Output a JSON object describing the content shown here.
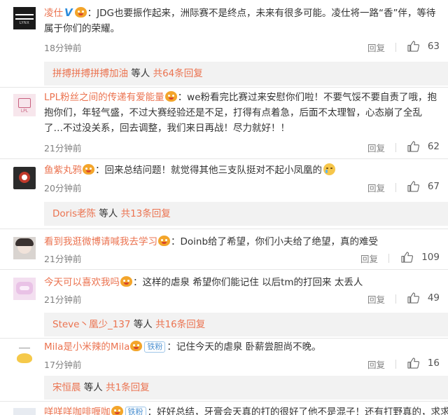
{
  "comments": [
    {
      "user": "凌仕",
      "has_v": true,
      "v_mark": "V",
      "fan_badge": "",
      "text": "：JDG也要振作起来，洲际赛不是终点，未来有很多可能。凌仕将一路“香”伴，等待属于你们的荣耀。",
      "time": "18分钟前",
      "reply_label": "回复",
      "likes": "63",
      "avatar_text": "LYNX"
    },
    {
      "user": "LPL粉丝之间的传递有爱能量",
      "has_v": false,
      "fan_badge": "",
      "text": "：we粉看完比赛过来安慰你们啦！不要气馁不要自责了哦，抱抱你们，年轻气盛，不过大赛经验还是不足，打得有点着急，后面不太理智，心态崩了全乱了…不过没关系，回去调整，我们来日再战！尽力就好！！",
      "time": "21分钟前",
      "reply_label": "回复",
      "likes": "62",
      "avatar_text": "LPL"
    },
    {
      "user": "鱼紫丸鸦",
      "has_v": false,
      "fan_badge": "",
      "text": "：回来总结问题！就觉得其他三支队挺对不起小凤凰的",
      "time": "20分钟前",
      "reply_label": "回复",
      "likes": "67",
      "avatar_text": ""
    },
    {
      "user": "看到我逛微博请喊我去学习",
      "has_v": false,
      "fan_badge": "",
      "text": "：Doinb给了希望，你们小夫给了绝望，真的难受",
      "time": "21分钟前",
      "reply_label": "回复",
      "likes": "109",
      "avatar_text": ""
    },
    {
      "user": "今天可以喜欢我吗",
      "has_v": false,
      "fan_badge": "",
      "text": "：这样的虐泉 希望你们能记住 以后tm的打回来 太丢人",
      "time": "21分钟前",
      "reply_label": "回复",
      "likes": "49",
      "avatar_text": ""
    },
    {
      "user": "Mila是小米辣的Mila",
      "has_v": false,
      "fan_badge": "铁粉",
      "text": "：记住今天的虐泉 卧薪尝胆尚不晚。",
      "time": "17分钟前",
      "reply_label": "回复",
      "likes": "16",
      "avatar_text": ""
    },
    {
      "user": "咩咩咩咖啡喱咖",
      "has_v": false,
      "fan_badge": "铁粉",
      "text": "：好好总结，牙膏会天真的打的很好了他不是混子！还有打野真的，求求",
      "time": "",
      "reply_label": "",
      "likes": "",
      "avatar_text": ""
    }
  ],
  "subreplies": [
    {
      "names": "拼搏拼搏拼搏加油",
      "mid": " 等人 ",
      "count_link": "共64条回复"
    },
    {
      "names": "Doris老陈",
      "mid": " 等人 ",
      "count_link": "共13条回复"
    },
    {
      "names": "Steve丶凰少_137",
      "mid": " 等人 ",
      "count_link": "共16条回复"
    },
    {
      "names": "宋恒晨",
      "mid": " 等人 ",
      "count_link": "共1条回复"
    }
  ],
  "colors": {
    "username": "#eb7350",
    "verified_v": "#2a8bdc",
    "subreply_bg": "#f2f2f2",
    "meta_text": "#808080"
  },
  "icons": {
    "like": "thumbs-up-icon",
    "vip": "vip-crown-face-icon",
    "verified": "verified-v-icon"
  }
}
